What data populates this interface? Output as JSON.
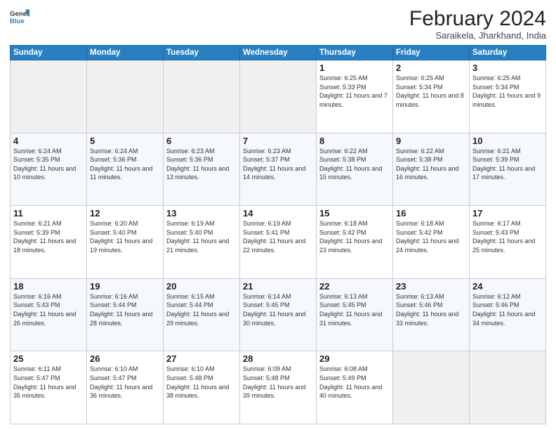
{
  "header": {
    "logo_general": "General",
    "logo_blue": "Blue",
    "title": "February 2024",
    "subtitle": "Saraikela, Jharkhand, India"
  },
  "days_of_week": [
    "Sunday",
    "Monday",
    "Tuesday",
    "Wednesday",
    "Thursday",
    "Friday",
    "Saturday"
  ],
  "weeks": [
    [
      {
        "num": "",
        "info": ""
      },
      {
        "num": "",
        "info": ""
      },
      {
        "num": "",
        "info": ""
      },
      {
        "num": "",
        "info": ""
      },
      {
        "num": "1",
        "info": "Sunrise: 6:25 AM\nSunset: 5:33 PM\nDaylight: 11 hours and 7 minutes."
      },
      {
        "num": "2",
        "info": "Sunrise: 6:25 AM\nSunset: 5:34 PM\nDaylight: 11 hours and 8 minutes."
      },
      {
        "num": "3",
        "info": "Sunrise: 6:25 AM\nSunset: 5:34 PM\nDaylight: 11 hours and 9 minutes."
      }
    ],
    [
      {
        "num": "4",
        "info": "Sunrise: 6:24 AM\nSunset: 5:35 PM\nDaylight: 11 hours and 10 minutes."
      },
      {
        "num": "5",
        "info": "Sunrise: 6:24 AM\nSunset: 5:36 PM\nDaylight: 11 hours and 11 minutes."
      },
      {
        "num": "6",
        "info": "Sunrise: 6:23 AM\nSunset: 5:36 PM\nDaylight: 11 hours and 13 minutes."
      },
      {
        "num": "7",
        "info": "Sunrise: 6:23 AM\nSunset: 5:37 PM\nDaylight: 11 hours and 14 minutes."
      },
      {
        "num": "8",
        "info": "Sunrise: 6:22 AM\nSunset: 5:38 PM\nDaylight: 11 hours and 15 minutes."
      },
      {
        "num": "9",
        "info": "Sunrise: 6:22 AM\nSunset: 5:38 PM\nDaylight: 11 hours and 16 minutes."
      },
      {
        "num": "10",
        "info": "Sunrise: 6:21 AM\nSunset: 5:39 PM\nDaylight: 11 hours and 17 minutes."
      }
    ],
    [
      {
        "num": "11",
        "info": "Sunrise: 6:21 AM\nSunset: 5:39 PM\nDaylight: 11 hours and 18 minutes."
      },
      {
        "num": "12",
        "info": "Sunrise: 6:20 AM\nSunset: 5:40 PM\nDaylight: 11 hours and 19 minutes."
      },
      {
        "num": "13",
        "info": "Sunrise: 6:19 AM\nSunset: 5:40 PM\nDaylight: 11 hours and 21 minutes."
      },
      {
        "num": "14",
        "info": "Sunrise: 6:19 AM\nSunset: 5:41 PM\nDaylight: 11 hours and 22 minutes."
      },
      {
        "num": "15",
        "info": "Sunrise: 6:18 AM\nSunset: 5:42 PM\nDaylight: 11 hours and 23 minutes."
      },
      {
        "num": "16",
        "info": "Sunrise: 6:18 AM\nSunset: 5:42 PM\nDaylight: 11 hours and 24 minutes."
      },
      {
        "num": "17",
        "info": "Sunrise: 6:17 AM\nSunset: 5:43 PM\nDaylight: 11 hours and 25 minutes."
      }
    ],
    [
      {
        "num": "18",
        "info": "Sunrise: 6:16 AM\nSunset: 5:43 PM\nDaylight: 11 hours and 26 minutes."
      },
      {
        "num": "19",
        "info": "Sunrise: 6:16 AM\nSunset: 5:44 PM\nDaylight: 11 hours and 28 minutes."
      },
      {
        "num": "20",
        "info": "Sunrise: 6:15 AM\nSunset: 5:44 PM\nDaylight: 11 hours and 29 minutes."
      },
      {
        "num": "21",
        "info": "Sunrise: 6:14 AM\nSunset: 5:45 PM\nDaylight: 11 hours and 30 minutes."
      },
      {
        "num": "22",
        "info": "Sunrise: 6:13 AM\nSunset: 5:45 PM\nDaylight: 11 hours and 31 minutes."
      },
      {
        "num": "23",
        "info": "Sunrise: 6:13 AM\nSunset: 5:46 PM\nDaylight: 11 hours and 33 minutes."
      },
      {
        "num": "24",
        "info": "Sunrise: 6:12 AM\nSunset: 5:46 PM\nDaylight: 11 hours and 34 minutes."
      }
    ],
    [
      {
        "num": "25",
        "info": "Sunrise: 6:11 AM\nSunset: 5:47 PM\nDaylight: 11 hours and 35 minutes."
      },
      {
        "num": "26",
        "info": "Sunrise: 6:10 AM\nSunset: 5:47 PM\nDaylight: 11 hours and 36 minutes."
      },
      {
        "num": "27",
        "info": "Sunrise: 6:10 AM\nSunset: 5:48 PM\nDaylight: 11 hours and 38 minutes."
      },
      {
        "num": "28",
        "info": "Sunrise: 6:09 AM\nSunset: 5:48 PM\nDaylight: 11 hours and 39 minutes."
      },
      {
        "num": "29",
        "info": "Sunrise: 6:08 AM\nSunset: 5:49 PM\nDaylight: 11 hours and 40 minutes."
      },
      {
        "num": "",
        "info": ""
      },
      {
        "num": "",
        "info": ""
      }
    ]
  ]
}
